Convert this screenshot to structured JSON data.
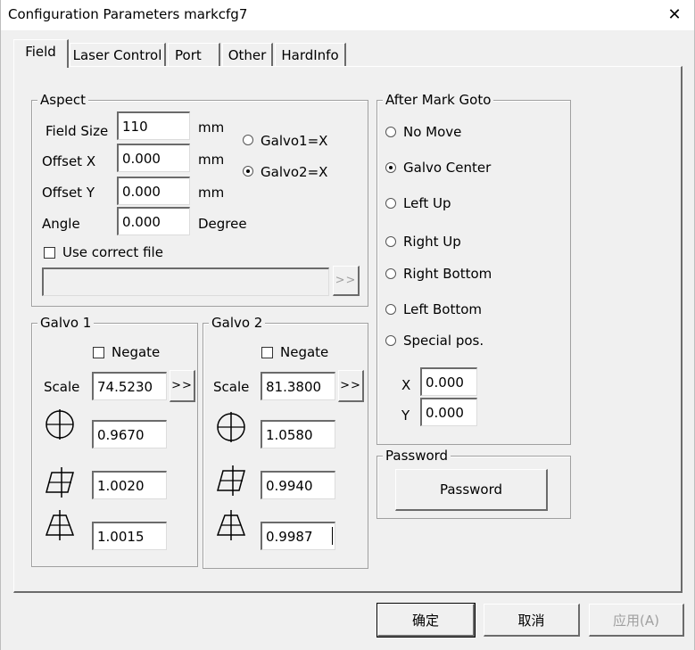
{
  "window": {
    "title": "Configuration Parameters markcfg7",
    "close_glyph": "✕"
  },
  "tabs": [
    {
      "label": "Field",
      "active": true
    },
    {
      "label": "Laser Control",
      "active": false
    },
    {
      "label": "Port",
      "active": false
    },
    {
      "label": "Other",
      "active": false
    },
    {
      "label": "HardInfo",
      "active": false
    }
  ],
  "aspect": {
    "group_label": "Aspect",
    "field_size": {
      "label": "Field Size",
      "value": "110",
      "unit": "mm"
    },
    "offset_x": {
      "label": "Offset X",
      "value": "0.000",
      "unit": "mm"
    },
    "offset_y": {
      "label": "Offset Y",
      "value": "0.000",
      "unit": "mm"
    },
    "angle": {
      "label": "Angle",
      "value": "0.000",
      "unit": "Degree"
    },
    "galvo1_x": {
      "label": "Galvo1=X",
      "selected": false
    },
    "galvo2_x": {
      "label": "Galvo2=X",
      "selected": true
    },
    "use_correct_file": {
      "label": "Use correct file",
      "checked": false
    },
    "correct_file_path": "",
    "browse_label": ">>"
  },
  "galvo1": {
    "group_label": "Galvo 1",
    "negate_label": "Negate",
    "negate_checked": false,
    "scale_label": "Scale",
    "scale_value": "74.5230",
    "scale_button": ">>",
    "barrel_value": "0.9670",
    "parallelogram_value": "1.0020",
    "trapezoid_value": "1.0015"
  },
  "galvo2": {
    "group_label": "Galvo 2",
    "negate_label": "Negate",
    "negate_checked": false,
    "scale_label": "Scale",
    "scale_value": "81.3800",
    "scale_button": ">>",
    "barrel_value": "1.0580",
    "parallelogram_value": "0.9940",
    "trapezoid_value": "0.9987"
  },
  "after_mark": {
    "group_label": "After Mark Goto",
    "options": [
      {
        "label": "No Move",
        "selected": false
      },
      {
        "label": "Galvo Center",
        "selected": true
      },
      {
        "label": "Left Up",
        "selected": false
      },
      {
        "label": "Right Up",
        "selected": false
      },
      {
        "label": "Right Bottom",
        "selected": false
      },
      {
        "label": "Left Bottom",
        "selected": false
      },
      {
        "label": "Special pos.",
        "selected": false
      }
    ],
    "x_label": "X",
    "x_value": "0.000",
    "y_label": "Y",
    "y_value": "0.000"
  },
  "password": {
    "group_label": "Password",
    "button_label": "Password"
  },
  "footer": {
    "ok_label": "确定",
    "cancel_label": "取消",
    "apply_label": "应用(A)"
  },
  "icons": {
    "barrel": "barrel-distortion-icon",
    "parallelogram": "parallelogram-distortion-icon",
    "trapezoid": "trapezoid-distortion-icon"
  },
  "colors": {
    "dialog_bg": "#f0f0f0",
    "titlebar_bg": "#ffffff",
    "disabled_text": "#a0a0a0"
  }
}
